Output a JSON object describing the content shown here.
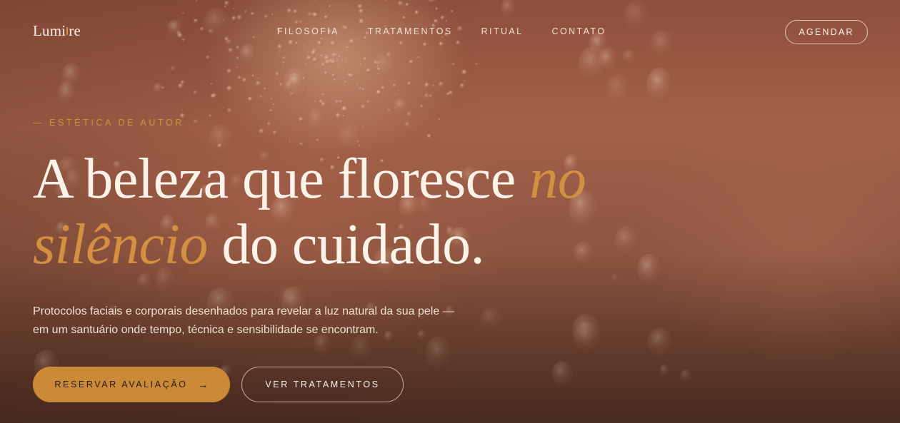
{
  "brand": {
    "logo_part1": "Lumi",
    "logo_part2": "re",
    "accent_color": "#d4913d"
  },
  "nav": {
    "items": [
      {
        "label": "FILOSOFIA"
      },
      {
        "label": "TRATAMENTOS"
      },
      {
        "label": "RITUAL"
      },
      {
        "label": "CONTATO"
      }
    ],
    "cta_label": "AGENDAR"
  },
  "hero": {
    "eyebrow": "— ESTÉTICA DE AUTOR",
    "headline_part1": "A beleza que floresce ",
    "headline_em1": "no",
    "headline_em2": "silêncio",
    "headline_part2": " do cuidado.",
    "lede": "Protocolos faciais e corporais desenhados para revelar a luz natural da sua pele — em um santuário onde tempo, técnica e sensibilidade se encontram.",
    "primary_button": "RESERVAR AVALIAÇÃO",
    "primary_button_arrow": "→",
    "secondary_button": "VER TRATAMENTOS"
  }
}
